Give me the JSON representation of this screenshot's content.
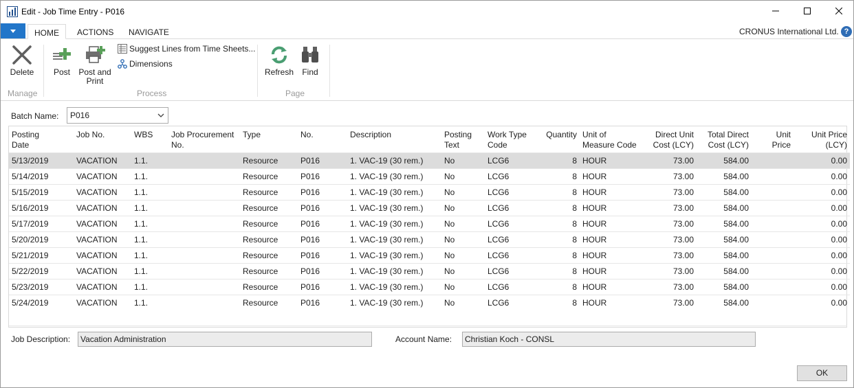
{
  "window": {
    "title": "Edit - Job Time Entry - P016"
  },
  "ribbon_tabs": [
    {
      "label": "HOME",
      "active": true
    },
    {
      "label": "ACTIONS",
      "active": false
    },
    {
      "label": "NAVIGATE",
      "active": false
    }
  ],
  "company": "CRONUS International Ltd.",
  "ribbon": {
    "manage": {
      "label": "Manage",
      "delete": "Delete"
    },
    "process": {
      "label": "Process",
      "post": "Post",
      "post_and_print_1": "Post and",
      "post_and_print_2": "Print",
      "suggest_lines": "Suggest Lines from Time Sheets...",
      "dimensions": "Dimensions"
    },
    "page": {
      "label": "Page",
      "refresh": "Refresh",
      "find": "Find"
    }
  },
  "batch": {
    "label": "Batch Name:",
    "value": "P016"
  },
  "grid": {
    "columns": [
      {
        "line1": "Posting",
        "line2": "Date"
      },
      {
        "line1": "Job No.",
        "line2": ""
      },
      {
        "line1": "WBS",
        "line2": ""
      },
      {
        "line1": "Job Procurement",
        "line2": "No."
      },
      {
        "line1": "Type",
        "line2": ""
      },
      {
        "line1": "No.",
        "line2": ""
      },
      {
        "line1": "Description",
        "line2": ""
      },
      {
        "line1": "Posting",
        "line2": "Text"
      },
      {
        "line1": "Work Type",
        "line2": "Code"
      },
      {
        "line1": "Quantity",
        "line2": ""
      },
      {
        "line1": "Unit of",
        "line2": "Measure Code"
      },
      {
        "line1": "Direct Unit",
        "line2": "Cost (LCY)"
      },
      {
        "line1": "Total Direct",
        "line2": "Cost (LCY)"
      },
      {
        "line1": "Unit",
        "line2": "Price"
      },
      {
        "line1": "Unit Price",
        "line2": "(LCY)"
      }
    ],
    "rows": [
      [
        "5/13/2019",
        "VACATION",
        "1.1.",
        "",
        "Resource",
        "P016",
        "1. VAC-19 (30 rem.)",
        "No",
        "LCG6",
        "8",
        "HOUR",
        "73.00",
        "584.00",
        "",
        "0.00"
      ],
      [
        "5/14/2019",
        "VACATION",
        "1.1.",
        "",
        "Resource",
        "P016",
        "1. VAC-19 (30 rem.)",
        "No",
        "LCG6",
        "8",
        "HOUR",
        "73.00",
        "584.00",
        "",
        "0.00"
      ],
      [
        "5/15/2019",
        "VACATION",
        "1.1.",
        "",
        "Resource",
        "P016",
        "1. VAC-19 (30 rem.)",
        "No",
        "LCG6",
        "8",
        "HOUR",
        "73.00",
        "584.00",
        "",
        "0.00"
      ],
      [
        "5/16/2019",
        "VACATION",
        "1.1.",
        "",
        "Resource",
        "P016",
        "1. VAC-19 (30 rem.)",
        "No",
        "LCG6",
        "8",
        "HOUR",
        "73.00",
        "584.00",
        "",
        "0.00"
      ],
      [
        "5/17/2019",
        "VACATION",
        "1.1.",
        "",
        "Resource",
        "P016",
        "1. VAC-19 (30 rem.)",
        "No",
        "LCG6",
        "8",
        "HOUR",
        "73.00",
        "584.00",
        "",
        "0.00"
      ],
      [
        "5/20/2019",
        "VACATION",
        "1.1.",
        "",
        "Resource",
        "P016",
        "1. VAC-19 (30 rem.)",
        "No",
        "LCG6",
        "8",
        "HOUR",
        "73.00",
        "584.00",
        "",
        "0.00"
      ],
      [
        "5/21/2019",
        "VACATION",
        "1.1.",
        "",
        "Resource",
        "P016",
        "1. VAC-19 (30 rem.)",
        "No",
        "LCG6",
        "8",
        "HOUR",
        "73.00",
        "584.00",
        "",
        "0.00"
      ],
      [
        "5/22/2019",
        "VACATION",
        "1.1.",
        "",
        "Resource",
        "P016",
        "1. VAC-19 (30 rem.)",
        "No",
        "LCG6",
        "8",
        "HOUR",
        "73.00",
        "584.00",
        "",
        "0.00"
      ],
      [
        "5/23/2019",
        "VACATION",
        "1.1.",
        "",
        "Resource",
        "P016",
        "1. VAC-19 (30 rem.)",
        "No",
        "LCG6",
        "8",
        "HOUR",
        "73.00",
        "584.00",
        "",
        "0.00"
      ],
      [
        "5/24/2019",
        "VACATION",
        "1.1.",
        "",
        "Resource",
        "P016",
        "1. VAC-19 (30 rem.)",
        "No",
        "LCG6",
        "8",
        "HOUR",
        "73.00",
        "584.00",
        "",
        "0.00"
      ]
    ]
  },
  "fields": {
    "job_description_label": "Job Description:",
    "job_description": "Vacation Administration",
    "account_name_label": "Account Name:",
    "account_name": "Christian Koch - CONSL"
  },
  "ok_label": "OK",
  "colors": {
    "accent": "#2276c9",
    "selected_row": "#dcdcdc",
    "post_green": "#5aa05a",
    "refresh_green": "#4a9e72"
  }
}
